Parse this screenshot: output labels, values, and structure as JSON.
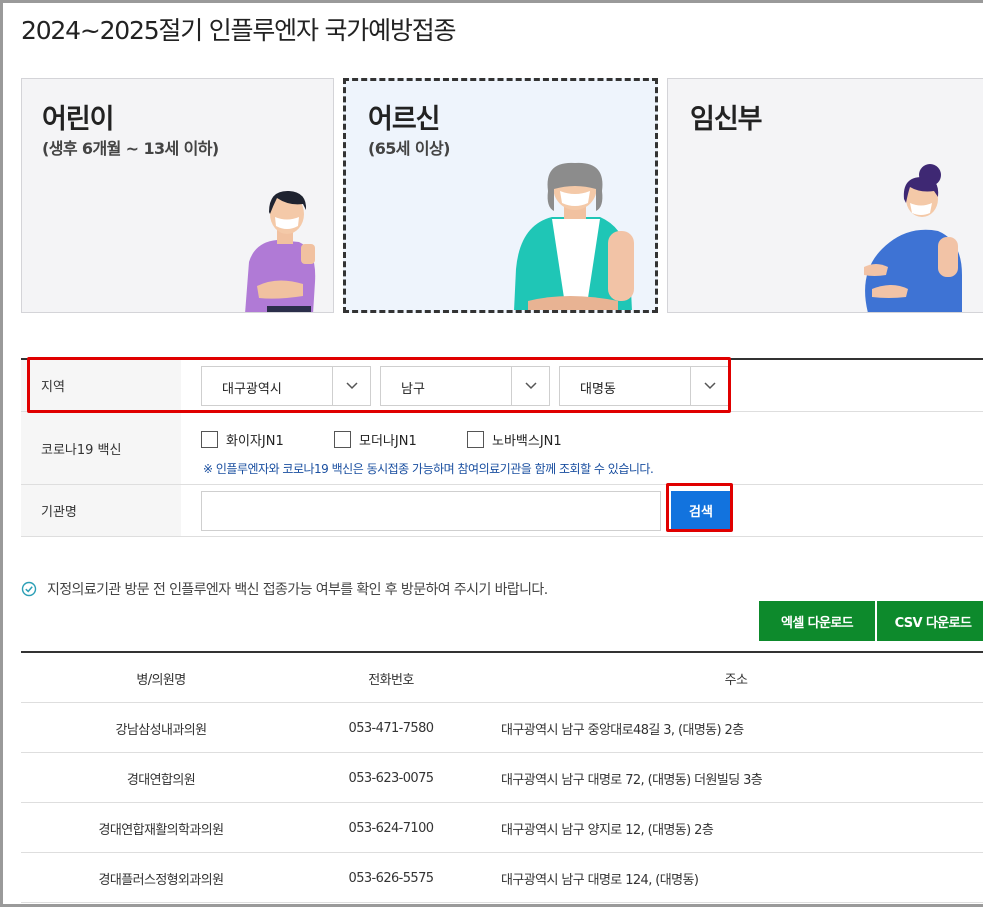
{
  "page": {
    "title": "2024~2025절기 인플루엔자 국가예방접종"
  },
  "cards": [
    {
      "title": "어린이",
      "subtitle": "(생후 6개월 ~ 13세 이하)",
      "selected": false
    },
    {
      "title": "어르신",
      "subtitle": "(65세 이상)",
      "selected": true
    },
    {
      "title": "임신부",
      "subtitle": "",
      "selected": false
    }
  ],
  "form": {
    "region_label": "지역",
    "region_selects": [
      {
        "value": "대구광역시"
      },
      {
        "value": "남구"
      },
      {
        "value": "대명동"
      }
    ],
    "covid_label": "코로나19 백신",
    "covid_options": [
      {
        "label": "화이자JN1",
        "checked": false
      },
      {
        "label": "모더나JN1",
        "checked": false
      },
      {
        "label": "노바백스JN1",
        "checked": false
      }
    ],
    "covid_note": "※ 인플루엔자와 코로나19 백신은 동시접종 가능하며 참여의료기관을 함께 조회할 수 있습니다.",
    "name_label": "기관명",
    "name_value": "",
    "search_label": "검색"
  },
  "notice": "지정의료기관 방문 전 인플루엔자 백신 접종가능 여부를 확인 후 방문하여 주시기 바랍니다.",
  "downloads": {
    "excel": "엑셀 다운로드",
    "csv": "CSV 다운로드"
  },
  "table": {
    "headers": [
      "병/의원명",
      "전화번호",
      "주소"
    ],
    "rows": [
      [
        "강남삼성내과의원",
        "053-471-7580",
        "대구광역시 남구 중앙대로48길 3, (대명동) 2층"
      ],
      [
        "경대연합의원",
        "053-623-0075",
        "대구광역시 남구 대명로 72, (대명동) 더원빌딩 3층"
      ],
      [
        "경대연합재활의학과의원",
        "053-624-7100",
        "대구광역시 남구 양지로 12, (대명동) 2층"
      ],
      [
        "경대플러스정형외과의원",
        "053-626-5575",
        "대구광역시 남구 대명로 124, (대명동)"
      ]
    ]
  },
  "colors": {
    "accent": "#1273de",
    "download": "#0d8a2c",
    "highlight": "#e00000",
    "note": "#1a4fa0"
  }
}
